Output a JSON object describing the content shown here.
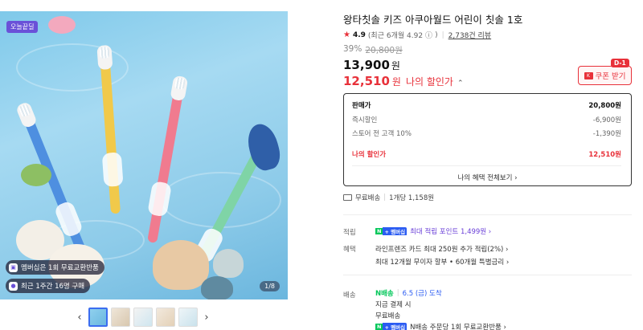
{
  "gallery": {
    "top_badge": "오늘끝딜",
    "pills": [
      {
        "icon": "app-icon",
        "text": "멤버십은 1회 무료교환반품"
      },
      {
        "icon": "user-icon",
        "text": "최근 1주간 16명 구매"
      }
    ],
    "page_indicator": "1/8",
    "thumbnails": [
      "thumb-1",
      "thumb-2",
      "thumb-3",
      "thumb-4",
      "thumb-5"
    ],
    "prev_arrow": "‹",
    "next_arrow": "›"
  },
  "product": {
    "title": "왕타칫솔 키즈 아쿠아월드 어린이 칫솔 1호",
    "rating": "4.9",
    "rating_detail": "(최근 6개월 4.92",
    "info_glyph": "ⓘ",
    "rating_detail_end": ")",
    "reviews": "2,738건 리뷰",
    "discount_pct": "39%",
    "original_price": "20,800원",
    "price": "13,900",
    "price_unit": "원",
    "my_price": "12,510",
    "my_price_unit": "원",
    "my_price_label": "나의 할인가",
    "coupon_badge": "D-1",
    "coupon_label": "쿠폰 받기",
    "coupon_icon_text": "K"
  },
  "breakdown": {
    "rows": [
      {
        "label": "판매가",
        "value": "20,800원"
      },
      {
        "label": "즉시할인",
        "value": "-6,900원"
      },
      {
        "label": "스토어 전 고객 10%",
        "value": "-1,390원"
      }
    ],
    "total_label": "나의 할인가",
    "total_value": "12,510원",
    "link": "나의 혜택 전체보기 ›"
  },
  "shipping_summary": {
    "free": "무료배송",
    "per_unit": "1개당 1,158원"
  },
  "points": {
    "label": "적립",
    "npay_n": "N",
    "npay_p": "+ 멤버십",
    "text": "최대 적립 포인트 1,499원 ›"
  },
  "benefits": {
    "label": "혜택",
    "line1": "라인프렌즈 카드 최대 250원 추가 적립(2%) ›",
    "line2": "최대 12개월 무이자 할부 • 60개월 특별금리 ›"
  },
  "delivery": {
    "label": "배송",
    "npay_badge": "N배송",
    "arrival": "6.5 (금) 도착",
    "payment": "지금 결제 시",
    "free": "무료배송",
    "npay_n": "N",
    "npay_p": "+ 멤버십",
    "return_text": "N배송 주문당 1회 무료교환반품 ›"
  },
  "colors": {
    "accent_red": "#e8313a",
    "brand_purple": "#6a51d8",
    "naver_green": "#03c75a"
  }
}
